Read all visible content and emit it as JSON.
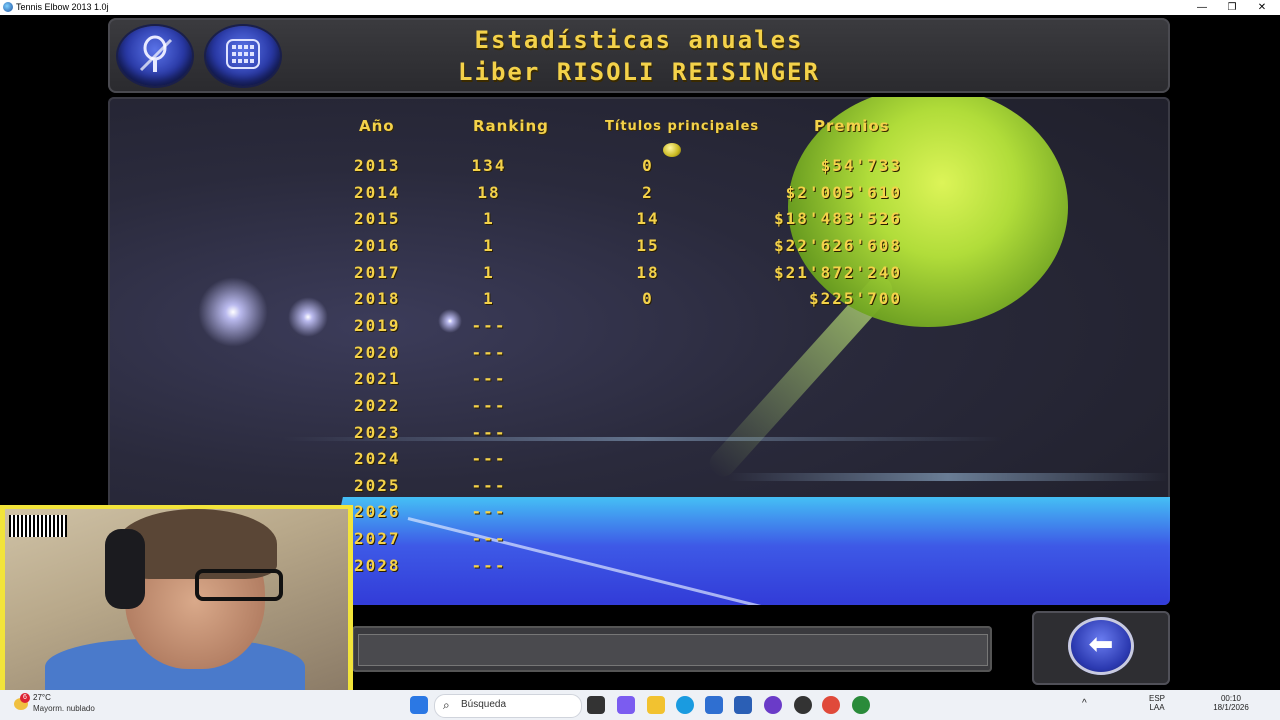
{
  "window": {
    "title": "Tennis Elbow 2013 1.0j",
    "minimize": "—",
    "maximize": "❐",
    "close": "✕"
  },
  "header": {
    "title": "Estadísticas anuales",
    "player": "Liber RISOLI REISINGER"
  },
  "table": {
    "headers": [
      "Año",
      "Ranking",
      "Títulos principales",
      "Premios"
    ],
    "rows": [
      [
        "2013",
        "134",
        "0",
        "$54'733"
      ],
      [
        "2014",
        "18",
        "2",
        "$2'005'610"
      ],
      [
        "2015",
        "1",
        "14",
        "$18'483'526"
      ],
      [
        "2016",
        "1",
        "15",
        "$22'626'608"
      ],
      [
        "2017",
        "1",
        "18",
        "$21'872'240"
      ],
      [
        "2018",
        "1",
        "0",
        "$225'700"
      ],
      [
        "2019",
        "---",
        "",
        ""
      ],
      [
        "2020",
        "---",
        "",
        ""
      ],
      [
        "2021",
        "---",
        "",
        ""
      ],
      [
        "2022",
        "---",
        "",
        ""
      ],
      [
        "2023",
        "---",
        "",
        ""
      ],
      [
        "2024",
        "---",
        "",
        ""
      ],
      [
        "2025",
        "---",
        "",
        ""
      ],
      [
        "2026",
        "---",
        "",
        ""
      ],
      [
        "2027",
        "---",
        "",
        ""
      ],
      [
        "2028",
        "---",
        "",
        ""
      ]
    ]
  },
  "icons": {
    "racket": "racket-icon",
    "calendar": "keypad-icon",
    "back": "back-arrow-icon",
    "trophy": "trophy-ball-icon"
  },
  "back_glyph": "⬅",
  "taskbar": {
    "weather_temp": "27°C",
    "weather_desc": "Mayorm. nublado",
    "weather_badge": "6",
    "search_placeholder": "Búsqueda",
    "lang": "ESP",
    "lang_sub": "LAA",
    "time": "00:10",
    "date": "18/1/2026"
  },
  "colors": {
    "accent_gold": "#f4d24a",
    "court_blue": "#3f5cf0",
    "webcam_frame": "#f2e43a"
  }
}
